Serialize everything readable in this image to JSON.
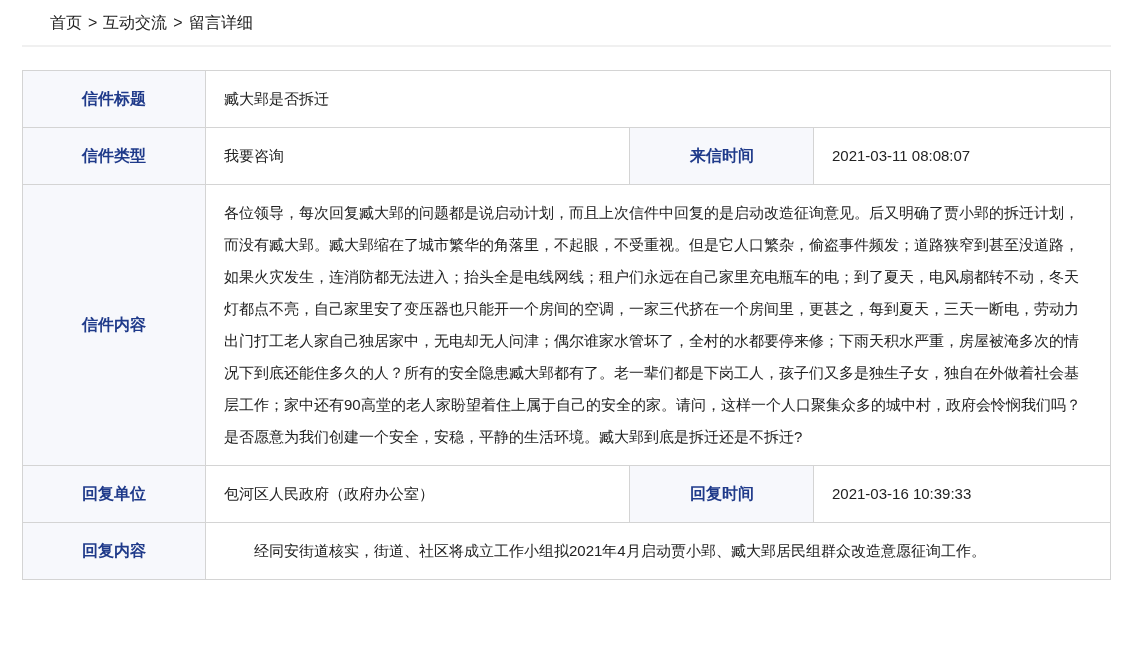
{
  "breadcrumb": {
    "items": [
      "首页",
      "互动交流",
      "留言详细"
    ],
    "separator": ">"
  },
  "rows": [
    {
      "kind": "plain",
      "fields": [
        {
          "label": "信件标题",
          "value": "臧大郢是否拆迁"
        }
      ]
    },
    {
      "kind": "plain",
      "fields": [
        {
          "label": "信件类型",
          "value": "我要咨询"
        },
        {
          "label": "来信时间",
          "value": "2021-03-11 08:08:07"
        }
      ]
    },
    {
      "kind": "plain",
      "fields": [
        {
          "label": "信件内容",
          "value": "各位领导，每次回复臧大郢的问题都是说启动计划，而且上次信件中回复的是启动改造征询意见。后又明确了贾小郢的拆迁计划，而没有臧大郢。臧大郢缩在了城市繁华的角落里，不起眼，不受重视。但是它人口繁杂，偷盗事件频发；道路狭窄到甚至没道路，如果火灾发生，连消防都无法进入；抬头全是电线网线；租户们永远在自己家里充电瓶车的电；到了夏天，电风扇都转不动，冬天灯都点不亮，自己家里安了变压器也只能开一个房间的空调，一家三代挤在一个房间里，更甚之，每到夏天，三天一断电，劳动力出门打工老人家自己独居家中，无电却无人问津；偶尔谁家水管坏了，全村的水都要停来修；下雨天积水严重，房屋被淹多次的情况下到底还能住多久的人？所有的安全隐患臧大郢都有了。老一辈们都是下岗工人，孩子们又多是独生子女，独自在外做着社会基层工作；家中还有90高堂的老人家盼望着住上属于自己的安全的家。请问，这样一个人口聚集众多的城中村，政府会怜悯我们吗？是否愿意为我们创建一个安全，安稳，平静的生活环境。臧大郢到底是拆迁还是不拆迁?"
        }
      ]
    },
    {
      "kind": "plain",
      "fields": [
        {
          "label": "回复单位",
          "value": "包河区人民政府（政府办公室）"
        },
        {
          "label": "回复时间",
          "value": "2021-03-16 10:39:33"
        }
      ]
    },
    {
      "kind": "indented",
      "fields": [
        {
          "label": "回复内容",
          "value": "经同安街道核实，街道、社区将成立工作小组拟2021年4月启动贾小郢、臧大郢居民组群众改造意愿征询工作。"
        }
      ]
    }
  ]
}
